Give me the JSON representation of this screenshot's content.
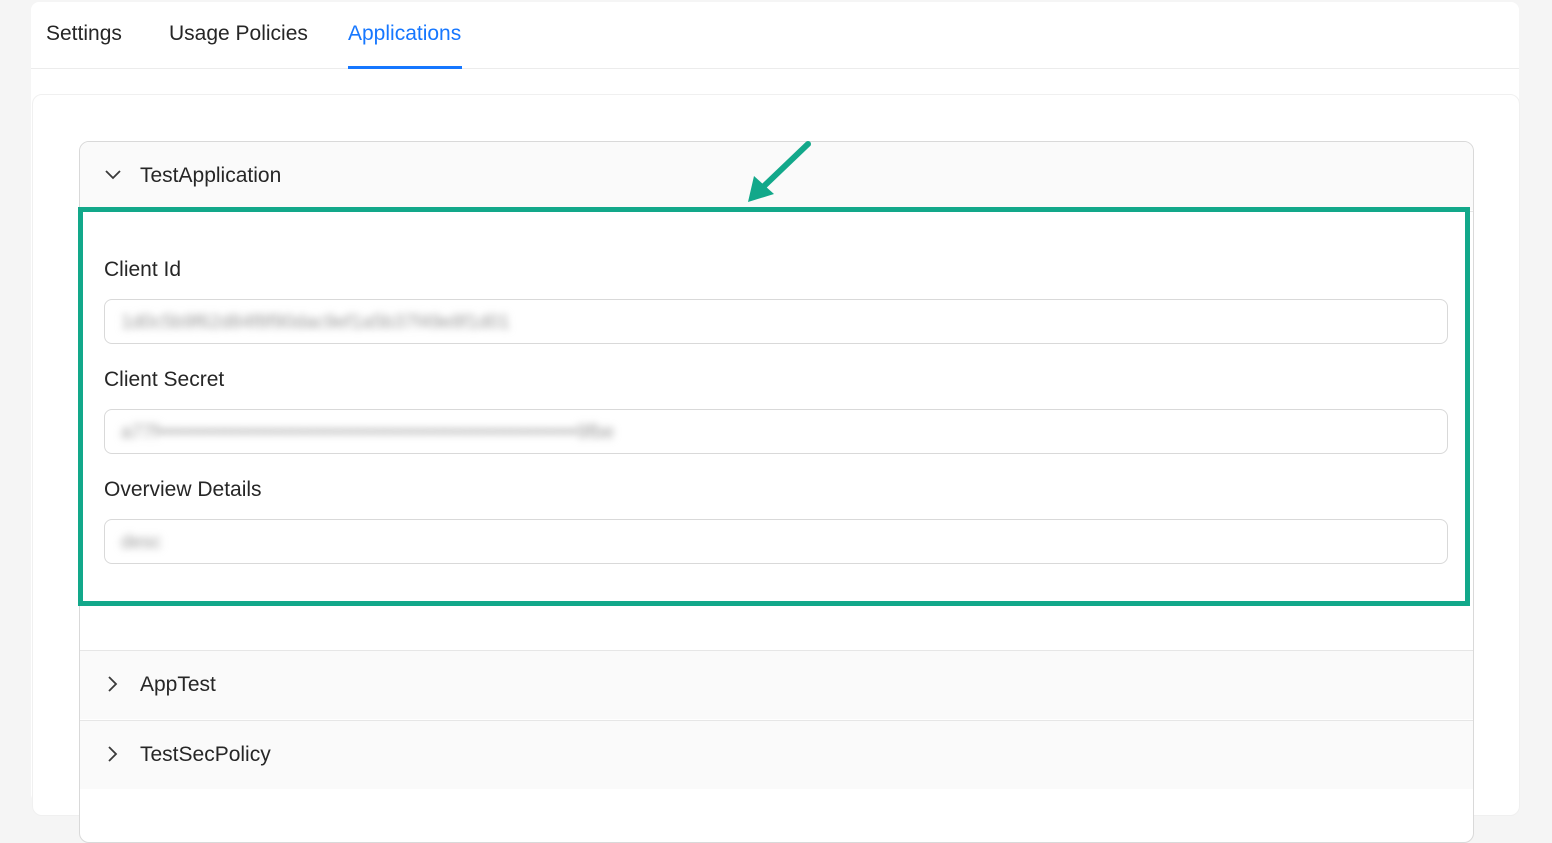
{
  "tabs": {
    "settings": "Settings",
    "usage_policies": "Usage Policies",
    "applications": "Applications",
    "active": "Applications"
  },
  "applications": {
    "panels": [
      {
        "name": "TestApplication",
        "expanded": true,
        "fields": {
          "client_id_label": "Client Id",
          "client_id_value": "1d0c5b9f62d84f8f90dac9ef1a5b37f49e8f1d01",
          "client_secret_label": "Client Secret",
          "client_secret_value": "a77f•••••••••••••••••••••••••••••••••••••••••••••••••••••••••••••••9fbe",
          "overview_label": "Overview Details",
          "overview_value": "desc"
        }
      },
      {
        "name": "AppTest",
        "expanded": false
      },
      {
        "name": "TestSecPolicy",
        "expanded": false
      }
    ]
  },
  "annotation": {
    "highlight_color": "#12a88a",
    "accent_color": "#1677ff"
  },
  "icons": {
    "expanded_chevron": "chevron-down-icon",
    "collapsed_chevron": "chevron-right-icon",
    "annotation_arrow": "arrow-icon"
  }
}
